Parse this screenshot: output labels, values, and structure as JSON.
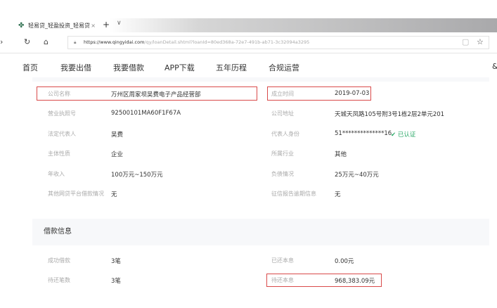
{
  "browser": {
    "tab_title": "轻易贷_轻盈投资_轻易贷",
    "url_domain": "https://www.qingyidai.com",
    "url_path": "/qy/loanDetail.shtml?loanId=80ed368a-72e7-491b-ab71-3c32094a3295"
  },
  "nav": [
    "首页",
    "我要出借",
    "我要借款",
    "APP下载",
    "五年历程",
    "合规运营"
  ],
  "company": {
    "left": [
      {
        "label": "公司名称",
        "value": "万州区周家坝吴费电子产品经营部"
      },
      {
        "label": "营业执照号",
        "value": "92500101MA60F1F67A"
      },
      {
        "label": "法定代表人",
        "value": "吴费"
      },
      {
        "label": "主体性质",
        "value": "企业"
      },
      {
        "label": "年收入",
        "value": "100万元~150万元"
      },
      {
        "label": "其他网贷平台借款情况",
        "value": "无"
      }
    ],
    "right": [
      {
        "label": "成立时间",
        "value": "2019-07-03"
      },
      {
        "label": "公司地址",
        "value": "天城天凤路105号附3号1栋2层2单元201"
      },
      {
        "label": "代表人身份",
        "value": "51**************16"
      },
      {
        "label": "所属行业",
        "value": "其他"
      },
      {
        "label": "负债情况",
        "value": "25万元~40万元"
      },
      {
        "label": "征信报告逾期信息",
        "value": "无"
      }
    ],
    "verified": "已认证"
  },
  "loan": {
    "title": "借款信息",
    "left": [
      {
        "label": "成功借款",
        "value": "3笔"
      },
      {
        "label": "待还笔数",
        "value": "3笔"
      }
    ],
    "right": [
      {
        "label": "已还本息",
        "value": "0.00元"
      },
      {
        "label": "待还本息",
        "value": "968,383.09元"
      }
    ]
  },
  "colors": {
    "highlight": "#d94a4a",
    "verified": "#2eaa6a"
  }
}
